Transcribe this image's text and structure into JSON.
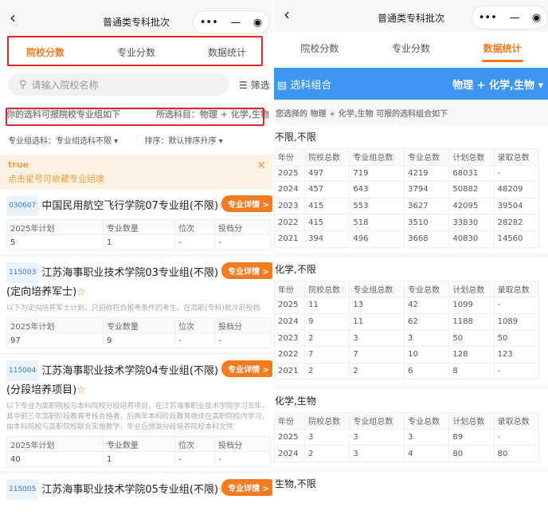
{
  "nav": {
    "title": "普通类专科批次",
    "back": "‹",
    "more": "•••",
    "minimize": "—",
    "close": "◉"
  },
  "tabs": [
    "院校分数",
    "专业分数",
    "数据统计"
  ],
  "left": {
    "search_placeholder": "请输入院校名称",
    "filter_label": "筛选",
    "info_left": "你的选科可报院校专业组如下",
    "info_right": "所选科目：物理 + 化学,生物",
    "filter_subject": "专业组选科：专业组选科不限",
    "filter_sort": "排序：默认排序升序",
    "notice_title": "true",
    "notice_text": "点击星号可收藏专业组噢",
    "detail_label": "专业详情 >",
    "table_headers": [
      "2025年计划",
      "专业数量",
      "位次",
      "投档分"
    ],
    "items": [
      {
        "code": "030607",
        "title": "中国民用航空飞行学院07专业组(不限)",
        "note": "",
        "row": [
          "5",
          "1",
          "-",
          "-"
        ]
      },
      {
        "code": "115003",
        "title": "江苏海事职业技术学院03专业组(不限)(定向培养军士)",
        "note": "以下为定向培养军士计划，只招收符合报考条件的考生，在高职(专科)批次前投档",
        "row": [
          "97",
          "9",
          "-",
          "-"
        ]
      },
      {
        "code": "115004",
        "title": "江苏海事职业技术学院04专业组(不限)(分段培养项目)",
        "note": "以下专业为高职院校与本科院校分段培养项目，在江苏海事职业技术学院学习五年，其中前三年高职阶段教育考核合格者，后两年本科阶段教育继续在高职院校内学习，由本科院校与高职院校联合实施教学，毕业后颁发分段培养院校本科文凭",
        "row": [
          "40",
          "1",
          "-",
          "-"
        ]
      },
      {
        "code": "115005",
        "title": "江苏海事职业技术学院05专业组(不限)",
        "note": "",
        "row": []
      }
    ]
  },
  "right": {
    "bar_label": "选科组合",
    "bar_value": "物理 + 化学,生物 ▾",
    "subtitle": "您选择的 物理 + 化学,生物 可报的选科组合如下",
    "headers": [
      "年份",
      "院校总数",
      "专业组总数",
      "专业总数",
      "计划总数",
      "录取总数"
    ],
    "sections": [
      {
        "title": "不限,不限",
        "rows": [
          [
            "2025",
            "497",
            "719",
            "4219",
            "68031",
            "-"
          ],
          [
            "2024",
            "457",
            "643",
            "3794",
            "50882",
            "48209"
          ],
          [
            "2023",
            "415",
            "553",
            "3627",
            "42095",
            "39504"
          ],
          [
            "2022",
            "415",
            "518",
            "3510",
            "33830",
            "28282"
          ],
          [
            "2021",
            "394",
            "496",
            "3668",
            "40830",
            "14560"
          ]
        ]
      },
      {
        "title": "化学,不限",
        "rows": [
          [
            "2025",
            "11",
            "13",
            "42",
            "1099",
            "-"
          ],
          [
            "2024",
            "9",
            "11",
            "62",
            "1188",
            "1089"
          ],
          [
            "2023",
            "2",
            "3",
            "3",
            "50",
            "50"
          ],
          [
            "2022",
            "7",
            "7",
            "10",
            "128",
            "123"
          ],
          [
            "2021",
            "2",
            "2",
            "6",
            "8",
            "-"
          ]
        ]
      },
      {
        "title": "化学,生物",
        "rows": [
          [
            "2025",
            "3",
            "3",
            "3",
            "89",
            "-"
          ],
          [
            "2024",
            "2",
            "3",
            "4",
            "80",
            "80"
          ]
        ]
      },
      {
        "title": "生物,不限",
        "rows": []
      }
    ]
  }
}
